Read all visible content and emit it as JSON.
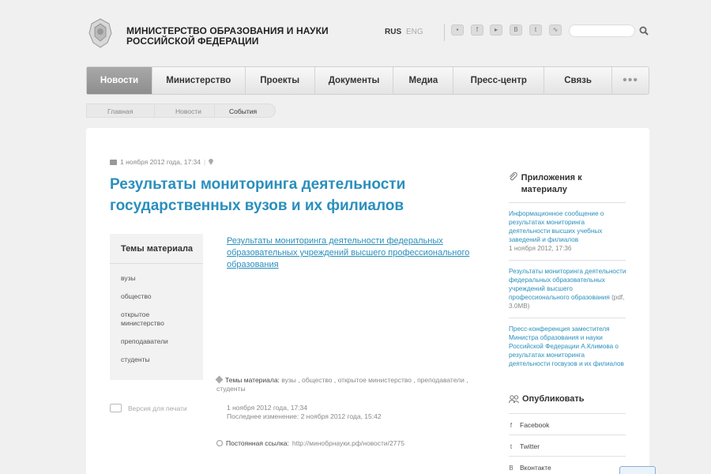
{
  "header": {
    "ministry_line1": "МИНИСТЕРСТВО ОБРАЗОВАНИЯ И НАУКИ",
    "ministry_line2": "РОССИЙСКОЙ ФЕДЕРАЦИИ",
    "lang_rus": "RUS",
    "lang_eng": "ENG",
    "social_icons": [
      "chat-icon",
      "facebook-icon",
      "youtube-icon",
      "vkontakte-icon",
      "twitter-icon",
      "rss-icon"
    ],
    "search_placeholder": ""
  },
  "nav": {
    "items": [
      {
        "label": "Новости",
        "active": true
      },
      {
        "label": "Министерство"
      },
      {
        "label": "Проекты"
      },
      {
        "label": "Документы"
      },
      {
        "label": "Медиа"
      },
      {
        "label": "Пресс-центр"
      },
      {
        "label": "Связь"
      }
    ],
    "more": "•••"
  },
  "breadcrumb": [
    "Главная",
    "Новости",
    "События"
  ],
  "article": {
    "date": "1 ноября 2012 года, 17:34",
    "separator": "|",
    "title": "Результаты мониторинга деятельности государственных вузов и их филиалов",
    "main_link": "Результаты мониторинга деятельности федеральных образовательных учреждений высшего профессионального образования",
    "topics_title": "Темы материала",
    "topics": [
      "вузы",
      "общество",
      "открытое министерство",
      "преподаватели",
      "студенты"
    ],
    "print_label": "Версия для печати",
    "tags_label": "Темы материала:",
    "tags_value": "вузы , общество , открытое министерство , преподаватели , студенты",
    "published": "1 ноября 2012 года, 17:34",
    "modified": "Последнее изменение: 2 ноября 2012 года, 15:42",
    "permalink_label": "Постоянная ссылка:",
    "permalink_url": "http://минобрнауки.рф/новости/2775"
  },
  "sidebar": {
    "attachments_title": "Приложения к материалу",
    "attachments": [
      {
        "title": "Информационное сообщение о результатах мониторинга деятельности высших учебных заведений и филиалов",
        "meta": "1 ноября 2012, 17:36"
      },
      {
        "title": "Результаты мониторинга деятельности федеральных образовательных учреждений высшего профессионального образования",
        "meta": "(pdf, 3.0MB)"
      },
      {
        "title": "Пресс-конференция заместителя Министра образования и науки Российской Федерации А.Климова о результатах мониторинга деятельности госвузов и их филиалов",
        "meta": ""
      }
    ],
    "publish_title": "Опубликовать",
    "share": [
      {
        "icon": "f",
        "label": "Facebook"
      },
      {
        "icon": "t",
        "label": "Twitter"
      },
      {
        "icon": "B",
        "label": "Вконтакте"
      }
    ]
  }
}
